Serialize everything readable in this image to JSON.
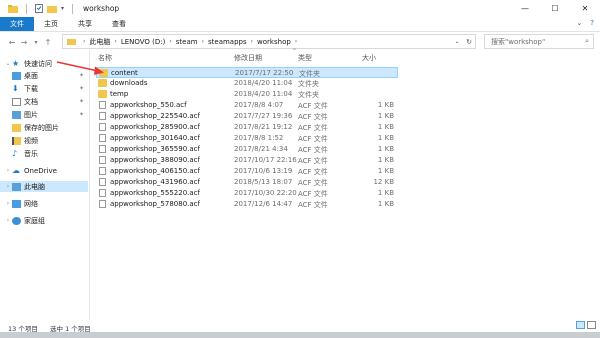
{
  "window": {
    "title": "workshop"
  },
  "ribbon": {
    "tabs": [
      "文件",
      "主页",
      "共享",
      "查看"
    ]
  },
  "address": {
    "crumbs": [
      "此电脑",
      "LENOVO (D:)",
      "steam",
      "steamapps",
      "workshop"
    ]
  },
  "search": {
    "placeholder": "搜索\"workshop\""
  },
  "nav": {
    "items": [
      {
        "label": "快速访问",
        "icon": "star-icon"
      },
      {
        "label": "桌面",
        "icon": "desktop-icon"
      },
      {
        "label": "下载",
        "icon": "download-icon"
      },
      {
        "label": "文档",
        "icon": "document-icon"
      },
      {
        "label": "图片",
        "icon": "picture-icon"
      },
      {
        "label": "保存的图片",
        "icon": "folder-icon"
      },
      {
        "label": "视频",
        "icon": "video-icon"
      },
      {
        "label": "音乐",
        "icon": "music-icon"
      },
      {
        "label": "OneDrive",
        "icon": "cloud-icon"
      },
      {
        "label": "此电脑",
        "icon": "computer-icon"
      },
      {
        "label": "网络",
        "icon": "network-icon"
      },
      {
        "label": "家庭组",
        "icon": "homegroup-icon"
      }
    ]
  },
  "columns": {
    "name": "名称",
    "date": "修改日期",
    "type": "类型",
    "size": "大小"
  },
  "files": [
    {
      "name": "content",
      "date": "2017/7/17 22:50",
      "type": "文件夹",
      "size": "",
      "kind": "folder"
    },
    {
      "name": "downloads",
      "date": "2018/4/20 11:04",
      "type": "文件夹",
      "size": "",
      "kind": "folder"
    },
    {
      "name": "temp",
      "date": "2018/4/20 11:04",
      "type": "文件夹",
      "size": "",
      "kind": "folder"
    },
    {
      "name": "appworkshop_550.acf",
      "date": "2017/8/8 4:07",
      "type": "ACF 文件",
      "size": "1 KB",
      "kind": "file"
    },
    {
      "name": "appworkshop_225540.acf",
      "date": "2017/7/27 19:36",
      "type": "ACF 文件",
      "size": "1 KB",
      "kind": "file"
    },
    {
      "name": "appworkshop_285900.acf",
      "date": "2017/8/21 19:12",
      "type": "ACF 文件",
      "size": "1 KB",
      "kind": "file"
    },
    {
      "name": "appworkshop_301640.acf",
      "date": "2017/8/8 1:52",
      "type": "ACF 文件",
      "size": "1 KB",
      "kind": "file"
    },
    {
      "name": "appworkshop_365590.acf",
      "date": "2017/8/21 4:34",
      "type": "ACF 文件",
      "size": "1 KB",
      "kind": "file"
    },
    {
      "name": "appworkshop_388090.acf",
      "date": "2017/10/17 22:16",
      "type": "ACF 文件",
      "size": "1 KB",
      "kind": "file"
    },
    {
      "name": "appworkshop_406150.acf",
      "date": "2017/10/6 13:19",
      "type": "ACF 文件",
      "size": "1 KB",
      "kind": "file"
    },
    {
      "name": "appworkshop_431960.acf",
      "date": "2018/5/13 18:07",
      "type": "ACF 文件",
      "size": "12 KB",
      "kind": "file"
    },
    {
      "name": "appworkshop_555220.acf",
      "date": "2017/10/30 22:20",
      "type": "ACF 文件",
      "size": "1 KB",
      "kind": "file"
    },
    {
      "name": "appworkshop_578080.acf",
      "date": "2017/12/6 14:47",
      "type": "ACF 文件",
      "size": "1 KB",
      "kind": "file"
    }
  ],
  "status": {
    "count": "13 个项目",
    "selected": "选中 1 个项目"
  },
  "colors": {
    "accent": "#1979ca",
    "selection": "#cce8ff",
    "folder": "#f0c64d",
    "annotation": "#e53935"
  }
}
